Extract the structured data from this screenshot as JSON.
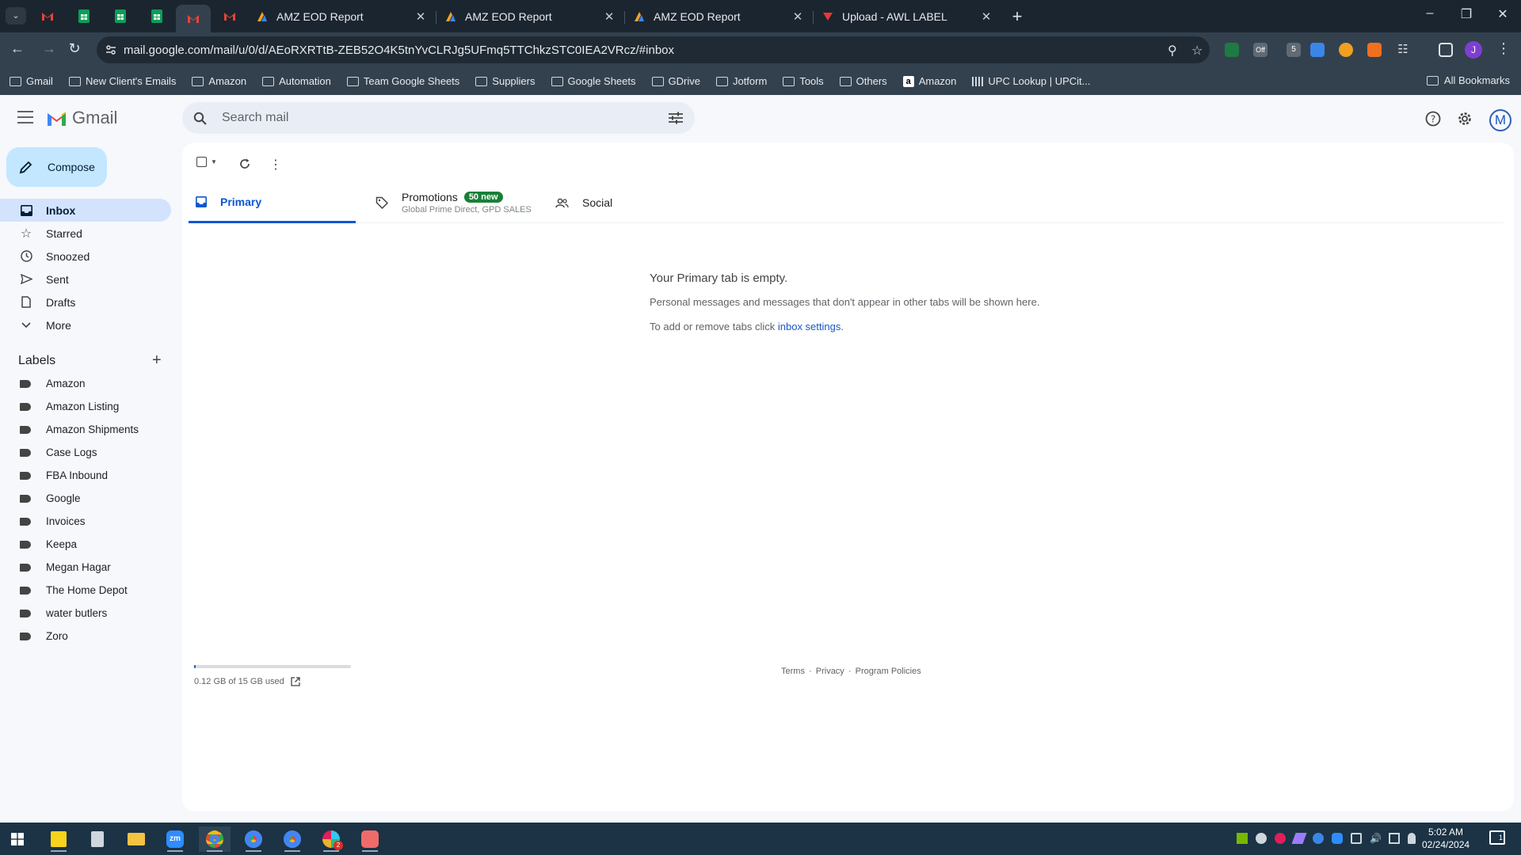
{
  "browser": {
    "tabs": [
      {
        "title": "AMZ EOD Report"
      },
      {
        "title": "AMZ EOD Report"
      },
      {
        "title": "AMZ EOD Report"
      },
      {
        "title": "Upload - AWL LABEL"
      }
    ],
    "url": "mail.google.com/mail/u/0/d/AEoRXRTtB-ZEB52O4K5tnYvCLRJg5UFmq5TTChkzSTC0IEA2VRcz/#inbox",
    "bookmarks": [
      "Gmail",
      "New Client's Emails",
      "Amazon",
      "Automation",
      "Team Google Sheets",
      "Suppliers",
      "Google Sheets",
      "GDrive",
      "Jotform",
      "Tools",
      "Others",
      "Amazon",
      "UPC Lookup | UPCit..."
    ],
    "all_bookmarks": "All Bookmarks",
    "profile_initial": "J",
    "extension_badge": "5",
    "extension_off": "Off"
  },
  "gmail": {
    "logo_text": "Gmail",
    "search_placeholder": "Search mail",
    "account_initial": "M",
    "compose_label": "Compose",
    "nav": [
      {
        "label": "Inbox",
        "icon": "inbox-icon"
      },
      {
        "label": "Starred",
        "icon": "star-icon"
      },
      {
        "label": "Snoozed",
        "icon": "clock-icon"
      },
      {
        "label": "Sent",
        "icon": "send-icon"
      },
      {
        "label": "Drafts",
        "icon": "draft-icon"
      },
      {
        "label": "More",
        "icon": "chevron-down-icon"
      }
    ],
    "labels_title": "Labels",
    "labels": [
      "Amazon",
      "Amazon Listing",
      "Amazon Shipments",
      "Case Logs",
      "FBA Inbound",
      "Google",
      "Invoices",
      "Keepa",
      "Megan Hagar",
      "The Home Depot",
      "water butlers",
      "Zoro"
    ],
    "category_tabs": {
      "primary": "Primary",
      "promotions": "Promotions",
      "promotions_badge": "50 new",
      "promotions_sub": "Global Prime Direct, GPD SALES",
      "social": "Social"
    },
    "empty": {
      "title": "Your Primary tab is empty.",
      "line1": "Personal messages and messages that don't appear in other tabs will be shown here.",
      "line2_prefix": "To add or remove tabs click ",
      "line2_link": "inbox settings",
      "line2_suffix": "."
    },
    "storage": {
      "text": "0.12 GB of 15 GB used",
      "fraction": 0.008
    },
    "footer": {
      "terms": "Terms",
      "privacy": "Privacy",
      "policies": "Program Policies",
      "sep": "·"
    }
  },
  "taskbar": {
    "time": "5:02 AM",
    "date": "02/24/2024",
    "notification_count": "1",
    "chrome_badge": "2"
  }
}
